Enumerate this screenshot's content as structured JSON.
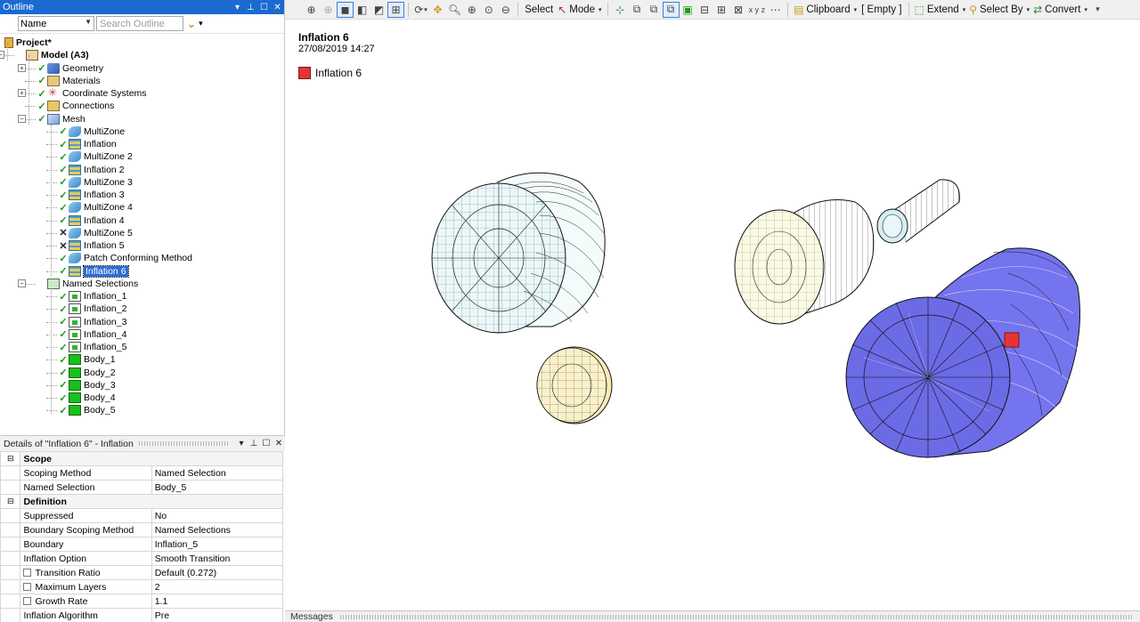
{
  "outline": {
    "title": "Outline",
    "pin_icon": "pin-icon",
    "name_select": "Name",
    "search_placeholder": "Search Outline"
  },
  "tree": [
    {
      "label": "Project*",
      "icon": "project-icon",
      "bold": true,
      "status": ""
    },
    {
      "label": "Model (A3)",
      "icon": "model-icon",
      "bold": true,
      "status": ""
    },
    {
      "label": "Geometry",
      "icon": "geometry-icon",
      "status": "ok"
    },
    {
      "label": "Materials",
      "icon": "materials-icon",
      "status": "ok"
    },
    {
      "label": "Coordinate Systems",
      "icon": "coordinate-systems-icon",
      "status": "ok"
    },
    {
      "label": "Connections",
      "icon": "connections-icon",
      "status": "ok"
    },
    {
      "label": "Mesh",
      "icon": "mesh-icon",
      "status": "ok"
    },
    {
      "label": "MultiZone",
      "icon": "multizone-icon",
      "status": "ok"
    },
    {
      "label": "Inflation",
      "icon": "inflation-icon",
      "status": "ok"
    },
    {
      "label": "MultiZone 2",
      "icon": "multizone-icon",
      "status": "ok"
    },
    {
      "label": "Inflation 2",
      "icon": "inflation-icon",
      "status": "ok"
    },
    {
      "label": "MultiZone 3",
      "icon": "multizone-icon",
      "status": "ok"
    },
    {
      "label": "Inflation 3",
      "icon": "inflation-icon",
      "status": "ok"
    },
    {
      "label": "MultiZone 4",
      "icon": "multizone-icon",
      "status": "ok"
    },
    {
      "label": "Inflation 4",
      "icon": "inflation-icon",
      "status": "ok"
    },
    {
      "label": "MultiZone 5",
      "icon": "multizone-icon",
      "status": "x"
    },
    {
      "label": "Inflation 5",
      "icon": "inflation-icon",
      "status": "x"
    },
    {
      "label": "Patch Conforming Method",
      "icon": "patch-conforming-icon",
      "status": "ok"
    },
    {
      "label": "Inflation 6",
      "icon": "inflation-icon",
      "status": "ok",
      "selected": true
    },
    {
      "label": "Named Selections",
      "icon": "named-selections-icon",
      "status": ""
    },
    {
      "label": "Inflation_1",
      "icon": "named-selection-icon",
      "status": "ok"
    },
    {
      "label": "Inflation_2",
      "icon": "named-selection-icon",
      "status": "ok"
    },
    {
      "label": "Inflation_3",
      "icon": "named-selection-icon",
      "status": "ok"
    },
    {
      "label": "Inflation_4",
      "icon": "named-selection-icon",
      "status": "ok"
    },
    {
      "label": "Inflation_5",
      "icon": "named-selection-icon",
      "status": "ok"
    },
    {
      "label": "Body_1",
      "icon": "body-icon",
      "status": "ok"
    },
    {
      "label": "Body_2",
      "icon": "body-icon",
      "status": "ok"
    },
    {
      "label": "Body_3",
      "icon": "body-icon",
      "status": "ok"
    },
    {
      "label": "Body_4",
      "icon": "body-icon",
      "status": "ok"
    },
    {
      "label": "Body_5",
      "icon": "body-icon",
      "status": "ok"
    }
  ],
  "details": {
    "title": "Details of \"Inflation 6\" - Inflation",
    "rows": [
      {
        "section": true,
        "label": "Scope",
        "expander": "⊟"
      },
      {
        "label": "Scoping Method",
        "value": "Named Selection"
      },
      {
        "label": "Named Selection",
        "value": "Body_5"
      },
      {
        "section": true,
        "label": "Definition",
        "expander": "⊟"
      },
      {
        "label": "Suppressed",
        "value": "No"
      },
      {
        "label": "Boundary Scoping Method",
        "value": "Named Selections"
      },
      {
        "label": "Boundary",
        "value": "Inflation_5"
      },
      {
        "label": "Inflation Option",
        "value": "Smooth Transition"
      },
      {
        "label": "Transition Ratio",
        "value": "Default (0.272)",
        "checkbox": true
      },
      {
        "label": "Maximum Layers",
        "value": "2",
        "checkbox": true
      },
      {
        "label": "Growth Rate",
        "value": "1.1",
        "checkbox": true
      },
      {
        "label": "Inflation Algorithm",
        "value": "Pre"
      }
    ]
  },
  "toolbar": {
    "select": "Select",
    "mode": "Mode",
    "clipboard": "Clipboard",
    "empty": "[ Empty ]",
    "extend": "Extend",
    "select_by": "Select By",
    "convert": "Convert"
  },
  "viewport": {
    "title": "Inflation 6",
    "date": "27/08/2019 14:27",
    "legend_label": "Inflation 6",
    "legend_color": "#e63434"
  },
  "messages": {
    "label": "Messages"
  },
  "colors": {
    "title_bar": "#1b6ad1",
    "selection": "#2f6ed1",
    "highlight_body": "#6b6be6"
  }
}
